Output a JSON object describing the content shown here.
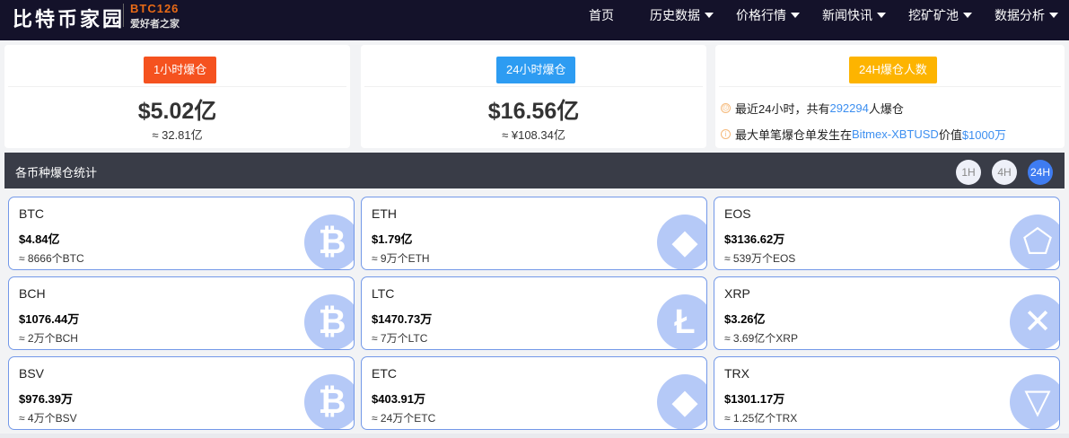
{
  "header": {
    "logo": "比特币家园",
    "logo_en": "BTC126",
    "logo_sub": "爱好者之家",
    "nav": [
      {
        "label": "首页",
        "dropdown": false
      },
      {
        "label": "历史数据",
        "dropdown": true
      },
      {
        "label": "价格行情",
        "dropdown": true
      },
      {
        "label": "新闻快讯",
        "dropdown": true
      },
      {
        "label": "挖矿矿池",
        "dropdown": true
      },
      {
        "label": "数据分析",
        "dropdown": true
      }
    ]
  },
  "summary": [
    {
      "badge": "1小时爆仓",
      "color": "#f5521f",
      "value": "$5.02亿",
      "sub": "≈ 32.81亿"
    },
    {
      "badge": "24小时爆仓",
      "color": "#2d9cf2",
      "value": "$16.56亿",
      "sub": "≈ ¥108.34亿"
    },
    {
      "badge": "24H爆仓人数",
      "color": "#fdb400",
      "line1": {
        "a": "最近24小时，共有",
        "b": "292294",
        "c": "人爆仓"
      },
      "line2": {
        "a": "最大单笔爆仓单发生在",
        "b": "Bitmex-XBTUSD",
        "c": "价值",
        "d": "$1000万"
      }
    }
  ],
  "section": {
    "title": "各币种爆仓统计",
    "periods": [
      "1H",
      "4H",
      "24H"
    ],
    "active": "24H"
  },
  "coins": [
    {
      "name": "BTC",
      "value": "$4.84亿",
      "amount": "≈ 8666个BTC",
      "icon": "bitcoin-icon",
      "glyph": "₿"
    },
    {
      "name": "ETH",
      "value": "$1.79亿",
      "amount": "≈ 9万个ETH",
      "icon": "ethereum-icon",
      "glyph": "◆"
    },
    {
      "name": "EOS",
      "value": "$3136.62万",
      "amount": "≈ 539万个EOS",
      "icon": "eos-icon",
      "glyph": "⬠"
    },
    {
      "name": "BCH",
      "value": "$1076.44万",
      "amount": "≈ 2万个BCH",
      "icon": "bitcoin-cash-icon",
      "glyph": "₿"
    },
    {
      "name": "LTC",
      "value": "$1470.73万",
      "amount": "≈ 7万个LTC",
      "icon": "litecoin-icon",
      "glyph": "Ł"
    },
    {
      "name": "XRP",
      "value": "$3.26亿",
      "amount": "≈ 3.69亿个XRP",
      "icon": "ripple-icon",
      "glyph": "✕"
    },
    {
      "name": "BSV",
      "value": "$976.39万",
      "amount": "≈ 4万个BSV",
      "icon": "bsv-icon",
      "glyph": "₿"
    },
    {
      "name": "ETC",
      "value": "$403.91万",
      "amount": "≈ 24万个ETC",
      "icon": "ethereum-classic-icon",
      "glyph": "◆"
    },
    {
      "name": "TRX",
      "value": "$1301.17万",
      "amount": "≈ 1.25亿个TRX",
      "icon": "tron-icon",
      "glyph": "▽"
    }
  ]
}
